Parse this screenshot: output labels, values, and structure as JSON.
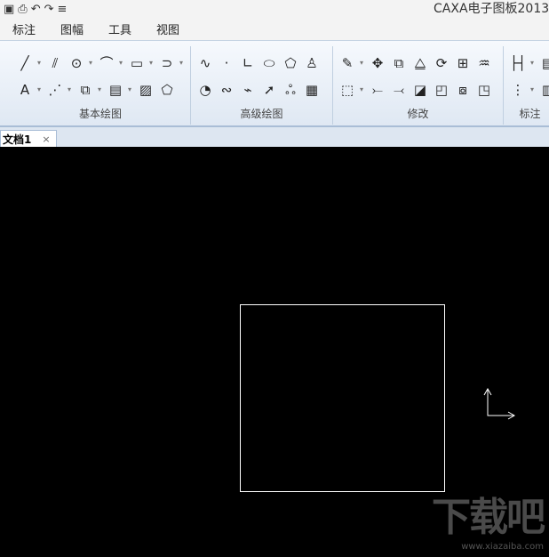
{
  "titlebar": {
    "title": "CAXA电子图板2013",
    "quick_access": [
      {
        "name": "save-icon",
        "glyph": "▣"
      },
      {
        "name": "print-icon",
        "glyph": "⎙"
      },
      {
        "name": "undo-icon",
        "glyph": "↶"
      },
      {
        "name": "redo-icon",
        "glyph": "↷"
      },
      {
        "name": "customize-icon",
        "glyph": "≡"
      }
    ]
  },
  "menu": [
    "标注",
    "图幅",
    "工具",
    "视图"
  ],
  "ribbon": {
    "groups": [
      {
        "label": "基本绘图",
        "rows": [
          [
            {
              "name": "line-icon",
              "glyph": "╱",
              "drop": true
            },
            {
              "name": "parallel-line-icon",
              "glyph": "⫽"
            },
            {
              "name": "circle-icon",
              "glyph": "⊙",
              "drop": true
            },
            {
              "name": "arc-icon",
              "glyph": "⌒",
              "drop": true
            },
            {
              "name": "rectangle-icon",
              "glyph": "▭",
              "drop": true
            },
            {
              "name": "polyline-icon",
              "glyph": "⊃",
              "drop": true
            }
          ],
          [
            {
              "name": "text-icon",
              "glyph": "A",
              "drop": true
            },
            {
              "name": "centerline-icon",
              "glyph": "⋰",
              "drop": true
            },
            {
              "name": "block-icon",
              "glyph": "⧉",
              "drop": true
            },
            {
              "name": "table-icon",
              "glyph": "▤",
              "drop": true
            },
            {
              "name": "hatch-icon",
              "glyph": "▨"
            },
            {
              "name": "fill-icon",
              "glyph": "⬠"
            }
          ]
        ]
      },
      {
        "label": "高级绘图",
        "rows": [
          [
            {
              "name": "spline-icon",
              "glyph": "∿"
            },
            {
              "name": "point-icon",
              "glyph": "·"
            },
            {
              "name": "angle-line-icon",
              "glyph": "∟"
            },
            {
              "name": "ellipse-icon",
              "glyph": "⬭"
            },
            {
              "name": "polygon-icon",
              "glyph": "⬠"
            },
            {
              "name": "hole-icon",
              "glyph": "♙"
            }
          ],
          [
            {
              "name": "circle-arc-icon",
              "glyph": "◔"
            },
            {
              "name": "wave-line-icon",
              "glyph": "∾"
            },
            {
              "name": "break-line-icon",
              "glyph": "⌁"
            },
            {
              "name": "arrow-icon",
              "glyph": "➚"
            },
            {
              "name": "cloud-icon",
              "glyph": "ஃ"
            },
            {
              "name": "shaft-icon",
              "glyph": "▦"
            }
          ]
        ]
      },
      {
        "label": "修改",
        "rows": [
          [
            {
              "name": "delete-icon",
              "glyph": "✎",
              "drop": true
            },
            {
              "name": "move-icon",
              "glyph": "✥"
            },
            {
              "name": "copy-icon",
              "glyph": "⧉"
            },
            {
              "name": "mirror-icon",
              "glyph": "⧋"
            },
            {
              "name": "rotate-icon",
              "glyph": "⟳"
            },
            {
              "name": "array-icon",
              "glyph": "⊞"
            },
            {
              "name": "offset-icon",
              "glyph": "♒"
            }
          ],
          [
            {
              "name": "trim-icon",
              "glyph": "⬚",
              "drop": true
            },
            {
              "name": "extend-icon",
              "glyph": "⤚"
            },
            {
              "name": "break-icon",
              "glyph": "⤙"
            },
            {
              "name": "stretch-icon",
              "glyph": "◪"
            },
            {
              "name": "chamfer-icon",
              "glyph": "◰"
            },
            {
              "name": "explode-icon",
              "glyph": "⧇"
            },
            {
              "name": "scale-icon",
              "glyph": "◳"
            }
          ]
        ]
      },
      {
        "label": "标注",
        "rows": [
          [
            {
              "name": "dimension-icon",
              "glyph": "├┤",
              "drop": true
            },
            {
              "name": "coordinate-dimension-icon",
              "glyph": "▤"
            }
          ],
          [
            {
              "name": "tolerance-icon",
              "glyph": "⋮",
              "drop": true
            },
            {
              "name": "symbol-icon",
              "glyph": "▥"
            }
          ]
        ]
      }
    ]
  },
  "tabs": [
    {
      "label": "文档1",
      "close": "×"
    }
  ],
  "watermark": {
    "brand": "下载吧",
    "url": "www.xiazaiba.com"
  }
}
